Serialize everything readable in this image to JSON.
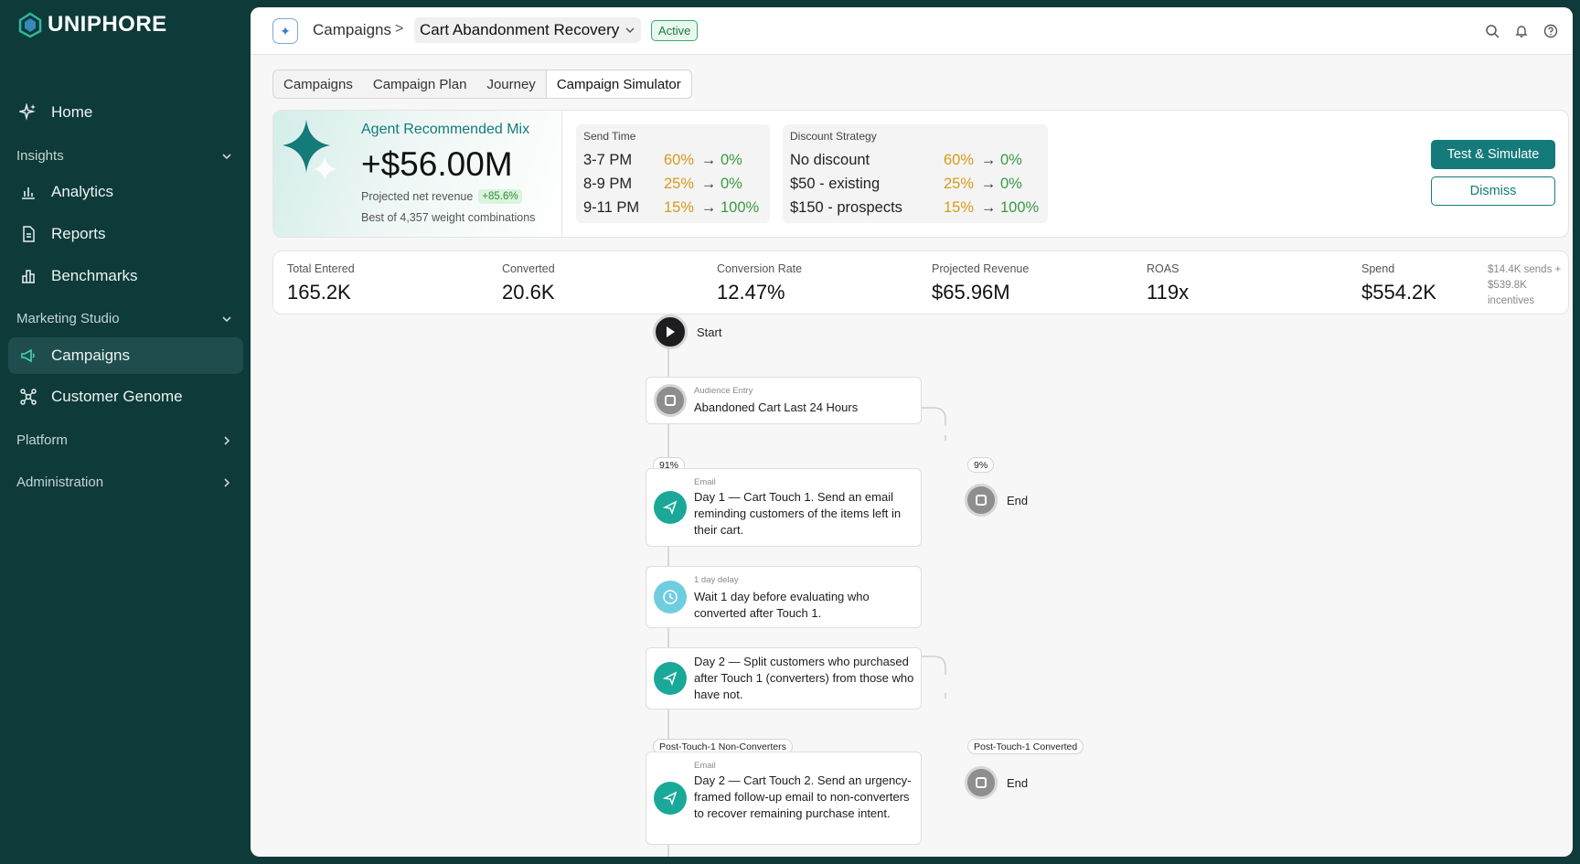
{
  "brand": {
    "name": "UNIPHORE"
  },
  "sidebar": {
    "home": "Home",
    "insights_section": "Insights",
    "analytics": "Analytics",
    "reports": "Reports",
    "benchmarks": "Benchmarks",
    "marketing_section": "Marketing Studio",
    "campaigns": "Campaigns",
    "genome": "Customer Genome",
    "platform_section": "Platform",
    "admin_section": "Administration"
  },
  "header": {
    "crumb_root": "Campaigns",
    "crumb_sep": ">",
    "crumb_current": "Cart Abandonment Recovery",
    "status": "Active"
  },
  "tabs": [
    "Campaigns",
    "Campaign Plan",
    "Journey",
    "Campaign Simulator"
  ],
  "recommendation": {
    "title": "Agent Recommended Mix",
    "value": "+$56.00M",
    "subtitle": "Projected net revenue",
    "badge": "+85.6%",
    "footnote": "Best of 4,357 weight combinations",
    "send_time": {
      "title": "Send Time",
      "rows": [
        {
          "label": "3-7 PM",
          "from": "60%",
          "to": "0%"
        },
        {
          "label": "8-9 PM",
          "from": "25%",
          "to": "0%"
        },
        {
          "label": "9-11 PM",
          "from": "15%",
          "to": "100%"
        }
      ]
    },
    "discount": {
      "title": "Discount Strategy",
      "rows": [
        {
          "label": "No discount",
          "from": "60%",
          "to": "0%"
        },
        {
          "label": "$50 - existing",
          "from": "25%",
          "to": "0%"
        },
        {
          "label": "$150 - prospects",
          "from": "15%",
          "to": "100%"
        }
      ]
    },
    "primary_button": "Test & Simulate",
    "secondary_button": "Dismiss"
  },
  "metrics": [
    {
      "label": "Total Entered",
      "value": "165.2K"
    },
    {
      "label": "Converted",
      "value": "20.6K"
    },
    {
      "label": "Conversion Rate",
      "value": "12.47%"
    },
    {
      "label": "Projected Revenue",
      "value": "$65.96M"
    },
    {
      "label": "ROAS",
      "value": "119x"
    },
    {
      "label": "Spend",
      "value": "$554.2K"
    }
  ],
  "spend_note_1": "$14.4K sends +",
  "spend_note_2": "$539.8K incentives",
  "flow": {
    "start": "Start",
    "audience_kind": "Audience Entry",
    "audience_text": "Abandoned Cart Last 24 Hours",
    "split1_left": "91%",
    "split1_right": "9%",
    "end_label": "End",
    "email1_kind": "Email",
    "email1_text": "Day 1 — Cart Touch 1. Send an email reminding customers of the items left in their cart.",
    "delay_kind": "1 day delay",
    "delay_text": "Wait 1 day before evaluating who converted after Touch 1.",
    "split_text": "Day 2 — Split customers who purchased after Touch 1 (converters) from those who have not.",
    "split2_left": "Post-Touch-1 Non-Converters",
    "split2_right": "Post-Touch-1 Converted",
    "email2_kind": "Email",
    "email2_text": "Day 2 — Cart Touch 2. Send an urgency-framed follow-up email to non-converters to recover remaining purchase intent."
  }
}
